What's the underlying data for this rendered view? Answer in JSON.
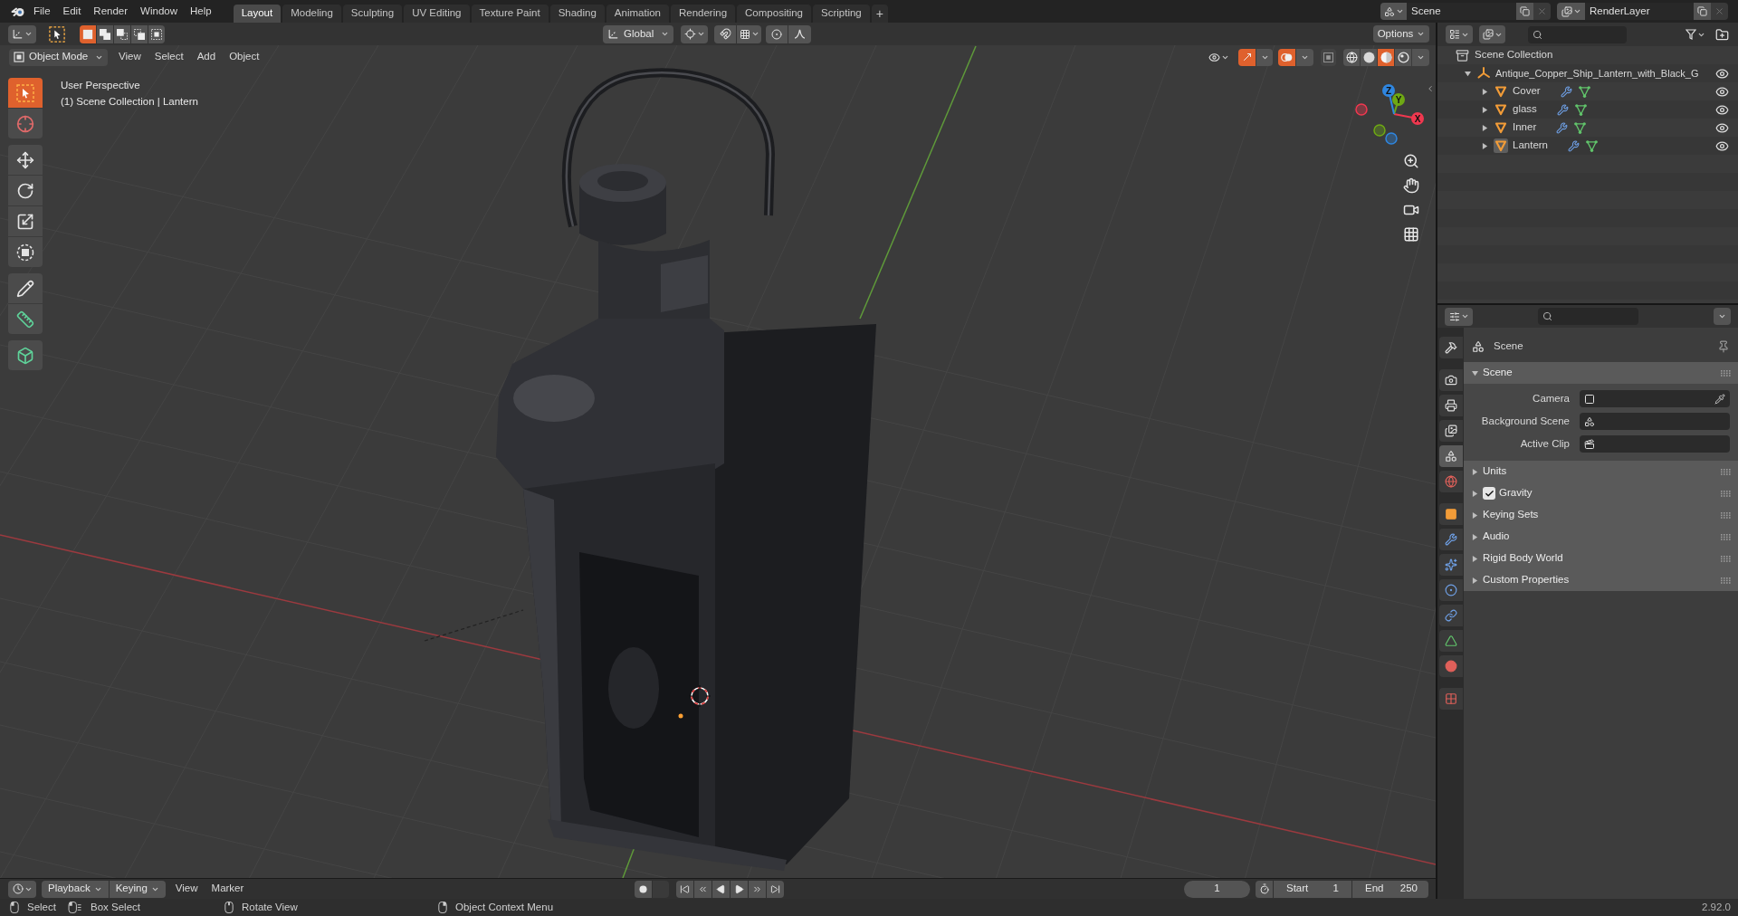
{
  "top_bar": {
    "menus": [
      "File",
      "Edit",
      "Render",
      "Window",
      "Help"
    ],
    "workspaces": [
      {
        "label": "Layout",
        "selected": true
      },
      {
        "label": "Modeling",
        "selected": false
      },
      {
        "label": "Sculpting",
        "selected": false
      },
      {
        "label": "UV Editing",
        "selected": false
      },
      {
        "label": "Texture Paint",
        "selected": false
      },
      {
        "label": "Shading",
        "selected": false
      },
      {
        "label": "Animation",
        "selected": false
      },
      {
        "label": "Rendering",
        "selected": false
      },
      {
        "label": "Compositing",
        "selected": false
      },
      {
        "label": "Scripting",
        "selected": false
      }
    ],
    "add_workspace": "+",
    "scene": "Scene",
    "view_layer": "RenderLayer"
  },
  "tool_header": {
    "select_modes": [
      {
        "kind": "set",
        "selected": true
      },
      {
        "kind": "extend",
        "selected": false
      },
      {
        "kind": "subtract",
        "selected": false
      },
      {
        "kind": "invert",
        "selected": false
      },
      {
        "kind": "intersect",
        "selected": false
      }
    ],
    "orientation": "Global",
    "options": "Options"
  },
  "viewport_header": {
    "mode": "Object Mode",
    "menus": [
      "View",
      "Select",
      "Add",
      "Object"
    ],
    "gizmos_on": true,
    "overlays_on": true,
    "xray_on": false,
    "shading": [
      {
        "kind": "wireframe",
        "selected": false
      },
      {
        "kind": "solid",
        "selected": false
      },
      {
        "kind": "material",
        "selected": true
      },
      {
        "kind": "rendered",
        "selected": false
      }
    ]
  },
  "toolbar": {
    "groups": [
      [
        {
          "kind": "select_box",
          "selected": true
        },
        {
          "kind": "cursor",
          "selected": false
        }
      ],
      [
        {
          "kind": "move",
          "selected": false
        },
        {
          "kind": "rotate",
          "selected": false
        },
        {
          "kind": "scale",
          "selected": false
        },
        {
          "kind": "transform",
          "selected": false
        }
      ],
      [
        {
          "kind": "annotate",
          "selected": false
        },
        {
          "kind": "measure",
          "selected": false
        }
      ],
      [
        {
          "kind": "add_cube",
          "selected": false
        }
      ]
    ]
  },
  "viewport": {
    "info": [
      "User Perspective",
      "(1) Scene Collection | Lantern"
    ],
    "gizmo_axes": [
      {
        "label": "X",
        "color": "#f0384f"
      },
      {
        "label": "Y",
        "color": "#6ea814"
      },
      {
        "label": "Z",
        "color": "#2f86e0"
      }
    ]
  },
  "outliner": {
    "root": "Scene Collection",
    "items": [
      {
        "name": "Antique_Copper_Ship_Lantern_with_Black_G",
        "kind": "empty",
        "expanded": true,
        "active": false,
        "visible": true,
        "children": [
          {
            "name": "Cover",
            "kind": "mesh",
            "expanded": false,
            "active": false,
            "visible": true
          },
          {
            "name": "glass",
            "kind": "mesh",
            "expanded": false,
            "active": false,
            "visible": true
          },
          {
            "name": "Inner",
            "kind": "mesh",
            "expanded": false,
            "active": false,
            "visible": true
          },
          {
            "name": "Lantern",
            "kind": "mesh",
            "expanded": false,
            "active": true,
            "visible": true
          }
        ]
      }
    ]
  },
  "properties": {
    "tab_groups": [
      [
        {
          "kind": "tool",
          "selected": false
        }
      ],
      [
        {
          "kind": "render",
          "selected": false
        },
        {
          "kind": "output",
          "selected": false
        },
        {
          "kind": "view_layer",
          "selected": false
        },
        {
          "kind": "scene",
          "selected": true
        },
        {
          "kind": "world",
          "selected": false
        }
      ],
      [
        {
          "kind": "object",
          "selected": false
        },
        {
          "kind": "modifiers",
          "selected": false
        },
        {
          "kind": "particles",
          "selected": false
        },
        {
          "kind": "physics",
          "selected": false
        },
        {
          "kind": "constraints",
          "selected": false
        },
        {
          "kind": "data",
          "selected": false
        },
        {
          "kind": "material",
          "selected": false
        }
      ],
      [
        {
          "kind": "texture",
          "selected": false
        }
      ]
    ],
    "context": "Scene",
    "panels": [
      {
        "title": "Scene",
        "expanded": true,
        "fields": [
          {
            "label": "Camera",
            "kind": "object"
          },
          {
            "label": "Background Scene",
            "kind": "scene"
          },
          {
            "label": "Active Clip",
            "kind": "clip"
          }
        ]
      },
      {
        "title": "Units",
        "expanded": false
      },
      {
        "title": "Gravity",
        "expanded": false,
        "checked": true
      },
      {
        "title": "Keying Sets",
        "expanded": false
      },
      {
        "title": "Audio",
        "expanded": false
      },
      {
        "title": "Rigid Body World",
        "expanded": false
      },
      {
        "title": "Custom Properties",
        "expanded": false
      }
    ]
  },
  "timeline": {
    "dropdowns": [
      "Playback",
      "Keying"
    ],
    "menus": [
      "View",
      "Marker"
    ],
    "current_frame": "1",
    "start": {
      "label": "Start",
      "value": "1"
    },
    "end": {
      "label": "End",
      "value": "250"
    }
  },
  "status_bar": {
    "hints": [
      {
        "kind": "left_click",
        "label": "Select"
      },
      {
        "kind": "left_drag",
        "label": "Box Select"
      },
      {
        "kind": "middle_click",
        "label": "Rotate View"
      },
      {
        "kind": "right_click",
        "label": "Object Context Menu"
      }
    ],
    "version": "2.92.0"
  }
}
